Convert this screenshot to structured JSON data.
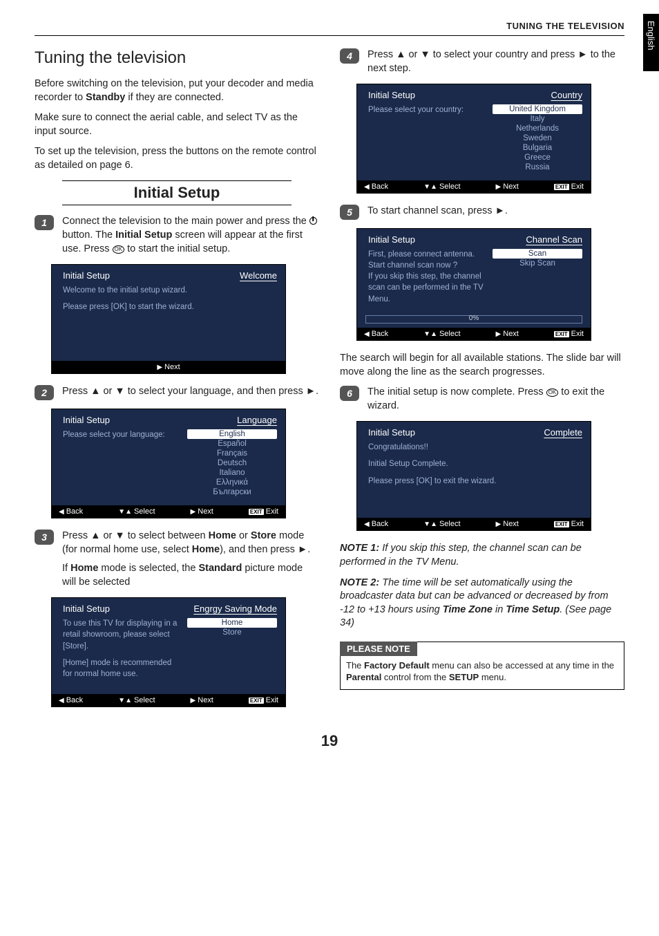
{
  "header": {
    "sectionTitle": "TUNING THE TELEVISION",
    "langTab": "English"
  },
  "title": "Tuning the television",
  "intro": {
    "p1a": "Before switching on the television, put your decoder and media recorder to ",
    "p1b": "Standby",
    "p1c": " if they are connected.",
    "p2": "Make sure to connect the aerial cable, and select TV as the input source.",
    "p3": "To set up the television, press the buttons on the remote control as detailed on page 6."
  },
  "sectionHeading": "Initial Setup",
  "steps": {
    "s1": {
      "num": "1",
      "a": "Connect the television to the main power and press the ",
      "b": " button. The ",
      "c": "Initial Setup",
      "d": " screen will appear at the first use. Press ",
      "e": " to start the initial setup.",
      "ok": "OK"
    },
    "s2": {
      "num": "2",
      "text": "Press ▲ or ▼ to select your language, and then press ►."
    },
    "s3": {
      "num": "3",
      "l1a": "Press ▲ or ▼ to select between ",
      "l1b": "Home",
      "l1c": " or ",
      "l1d": "Store",
      "l1e": " mode (for normal home use, select ",
      "l1f": "Home",
      "l1g": "), and then press ►.",
      "l2a": "If ",
      "l2b": "Home",
      "l2c": " mode is selected, the ",
      "l2d": "Standard",
      "l2e": " picture mode will be selected"
    },
    "s4": {
      "num": "4",
      "text": "Press ▲ or ▼ to select your country and press ► to the next step."
    },
    "s5": {
      "num": "5",
      "text": "To start channel scan, press ►."
    },
    "s5after": "The search will begin for all available stations. The slide bar will move along the line as the search progresses.",
    "s6": {
      "num": "6",
      "a": "The initial setup is now complete. Press ",
      "b": " to exit the wizard.",
      "ok": "OK"
    }
  },
  "osd": {
    "initialSetup": "Initial Setup",
    "nav": {
      "back": "Back",
      "select": "Select",
      "next": "Next",
      "exit": "Exit",
      "exitBadge": "EXIT"
    },
    "tri": {
      "left": "◀",
      "right": "▶",
      "updown": "▼▲"
    },
    "welcome": {
      "title": "Welcome",
      "l1": "Welcome to the initial setup wizard.",
      "l2": "Please press [OK] to start the wizard."
    },
    "language": {
      "title": "Language",
      "prompt": "Please select your language:",
      "opts": [
        "English",
        "Español",
        "Français",
        "Deutsch",
        "Italiano",
        "Ελληνικά",
        "Български"
      ]
    },
    "energy": {
      "title": "Engrgy Saving Mode",
      "l1": "To use this TV for displaying in a retail showroom, please select [Store].",
      "l2": "[Home] mode is recommended for normal home use.",
      "opts": [
        "Home",
        "Store"
      ]
    },
    "country": {
      "title": "Country",
      "prompt": "Please select your country:",
      "opts": [
        "United Kingdom",
        "Italy",
        "Netherlands",
        "Sweden",
        "Bulgaria",
        "Greece",
        "Russia"
      ]
    },
    "scan": {
      "title": "Channel Scan",
      "msg": "First, please connect antenna.\nStart channel scan now ?\nIf you skip this step, the channel scan can be performed in the TV Menu.",
      "opts": [
        "Scan",
        "Skip Scan"
      ],
      "progress": "0%"
    },
    "complete": {
      "title": "Complete",
      "l1": "Congratulations!!",
      "l2": "Initial Setup Complete.",
      "l3": "Please press [OK] to exit the wizard."
    }
  },
  "notes": {
    "n1a": "NOTE 1:",
    "n1b": " If you skip this step, the channel scan can be performed in the TV Menu.",
    "n2a": "NOTE 2:",
    "n2b": " The time will be set automatically using the broadcaster data but can be advanced or decreased by from -12 to +13 hours using ",
    "n2c": "Time Zone",
    "n2d": " in ",
    "n2e": "Time Setup",
    "n2f": ". (See page 34)"
  },
  "pleaseNote": {
    "tab": "PLEASE NOTE",
    "a": "The ",
    "b": "Factory Default",
    "c": " menu can also be accessed at any time in the ",
    "d": "Parental",
    "e": " control from the ",
    "f": "SETUP",
    "g": " menu."
  },
  "pageNumber": "19"
}
